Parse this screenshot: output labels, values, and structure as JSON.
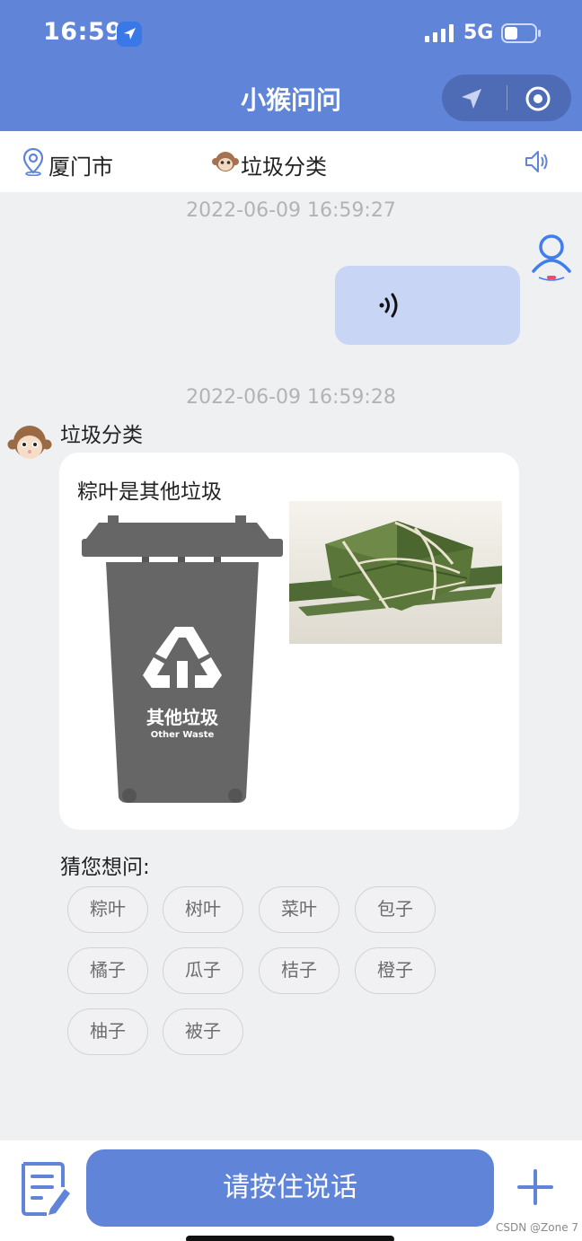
{
  "status_bar": {
    "time": "16:59",
    "network": "5G"
  },
  "header": {
    "title": "小猴问问"
  },
  "subheader": {
    "city": "厦门市",
    "mode": "垃圾分类"
  },
  "chat": {
    "messages": [
      {
        "sender": "user",
        "timestamp": "2022-06-09 16:59:27",
        "type": "voice"
      },
      {
        "sender": "bot",
        "timestamp": "2022-06-09 16:59:28",
        "name": "垃圾分类",
        "text": "粽叶是其他垃圾",
        "bin_label": "其他垃圾",
        "bin_sublabel": "Other Waste",
        "bin_color": "#666666"
      }
    ]
  },
  "suggestions": {
    "label": "猜您想问:",
    "items": [
      "粽叶",
      "树叶",
      "菜叶",
      "包子",
      "橘子",
      "瓜子",
      "桔子",
      "橙子",
      "柚子",
      "被子"
    ]
  },
  "bottom_bar": {
    "hold_label": "请按住说话"
  },
  "watermark": "CSDN @Zone 7",
  "colors": {
    "primary": "#5f84d8",
    "voice_bubble": "#c9d5f5",
    "background": "#eff0f2"
  },
  "icons": [
    "location-arrow-icon",
    "signal-icon",
    "battery-icon",
    "navigate-icon",
    "target-icon",
    "location-pin-icon",
    "monkey-icon",
    "speaker-icon",
    "user-avatar-icon",
    "voice-wave-icon",
    "edit-icon",
    "plus-icon"
  ]
}
